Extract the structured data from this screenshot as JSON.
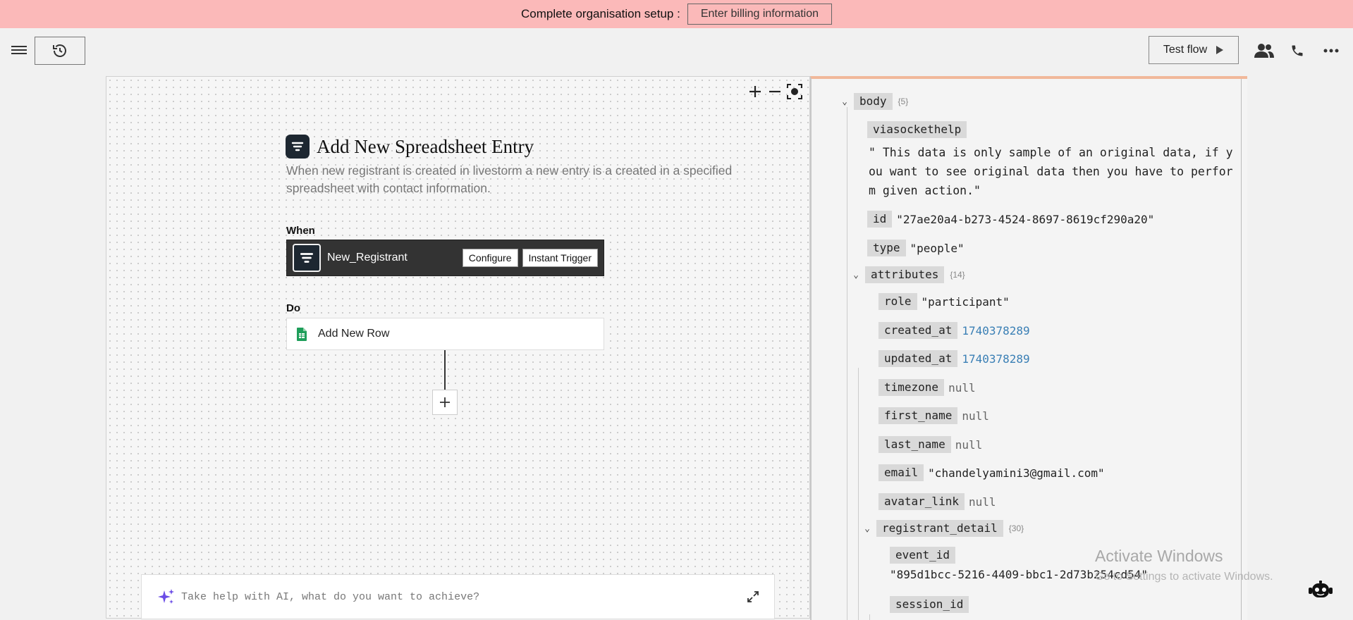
{
  "banner": {
    "text": "Complete organisation setup :",
    "button_label": "Enter billing information"
  },
  "toolbar": {
    "test_flow_label": "Test flow"
  },
  "flow": {
    "title": "Add New Spreadsheet Entry",
    "description": "When new registrant is created in livestorm a new entry is a created in a specified spreadsheet with contact information.",
    "when_label": "When",
    "trigger": {
      "name": "New_Registrant",
      "configure_label": "Configure",
      "instant_trigger_label": "Instant Trigger"
    },
    "do_label": "Do",
    "action": {
      "name": "Add New Row"
    }
  },
  "ai_bar": {
    "placeholder": "Take help with AI, what do you want to achieve?"
  },
  "data_panel": {
    "body": {
      "key": "body",
      "count": "{5}"
    },
    "viasockethelp": {
      "key": "viasockethelp",
      "value": "\" This data is only sample of an original data, if you want to see original data then you have to perform given action.\""
    },
    "id": {
      "key": "id",
      "value": "\"27ae20a4-b273-4524-8697-8619cf290a20\""
    },
    "type": {
      "key": "type",
      "value": "\"people\""
    },
    "attributes": {
      "key": "attributes",
      "count": "{14}"
    },
    "role": {
      "key": "role",
      "value": "\"participant\""
    },
    "created_at": {
      "key": "created_at",
      "value": "1740378289"
    },
    "updated_at": {
      "key": "updated_at",
      "value": "1740378289"
    },
    "timezone": {
      "key": "timezone",
      "value": "null"
    },
    "first_name": {
      "key": "first_name",
      "value": "null"
    },
    "last_name": {
      "key": "last_name",
      "value": "null"
    },
    "email": {
      "key": "email",
      "value": "\"chandelyamini3@gmail.com\""
    },
    "avatar_link": {
      "key": "avatar_link",
      "value": "null"
    },
    "registrant_detail": {
      "key": "registrant_detail",
      "count": "{30}"
    },
    "event_id": {
      "key": "event_id",
      "value": "\"895d1bcc-5216-4409-bbc1-2d73b254cd54\""
    },
    "session_id": {
      "key": "session_id"
    }
  },
  "watermark": {
    "title": "Activate Windows",
    "subtitle": "Go to Settings to activate Windows."
  },
  "colors": {
    "banner_bg": "#fbb9b9",
    "panel_accent": "#f1b89a",
    "number_value": "#3a7fb5",
    "trigger_card_bg": "#333333",
    "sheets_green": "#1e9e5a"
  }
}
